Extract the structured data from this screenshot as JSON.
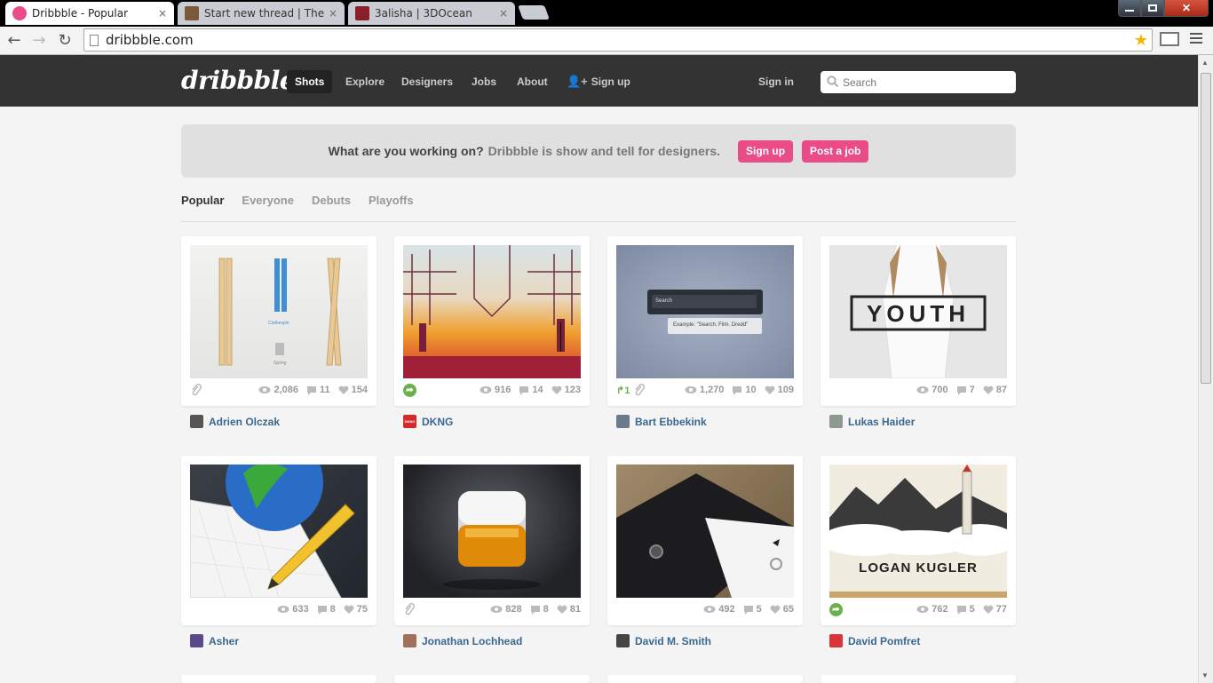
{
  "browser": {
    "tabs": [
      {
        "title": "Dribbble - Popular",
        "close": "×",
        "active": true
      },
      {
        "title": "Start new thread | ThemeFo",
        "close": "×",
        "active": false
      },
      {
        "title": "3alisha | 3DOcean",
        "close": "×",
        "active": false
      }
    ],
    "url": "dribbble.com"
  },
  "header": {
    "logo": "dribbble",
    "nav": [
      "Shots",
      "Explore",
      "Designers",
      "Jobs",
      "About",
      "Sign up"
    ],
    "sign_in": "Sign in",
    "search_placeholder": "Search"
  },
  "banner": {
    "question": "What are you working on?",
    "statement": "Dribbble is show and tell for designers.",
    "signup": "Sign up",
    "post_job": "Post a job"
  },
  "filters": [
    "Popular",
    "Everyone",
    "Debuts",
    "Playoffs"
  ],
  "shots": [
    {
      "player": "Adrien Olczak",
      "views": "2,086",
      "comments": "11",
      "likes": "154",
      "attachment": true,
      "rebound": false,
      "thumb_texts": [
        "Clothespin",
        "Spring"
      ]
    },
    {
      "player": "DKNG",
      "views": "916",
      "comments": "14",
      "likes": "123",
      "attachment": false,
      "rebound": true,
      "avatar_text": "DKNG"
    },
    {
      "player": "Bart Ebbekink",
      "views": "1,270",
      "comments": "10",
      "likes": "109",
      "attachment": true,
      "rebound_count": "1",
      "thumb_texts": [
        "Search",
        "Example: \"Search. Film. Dredd\""
      ]
    },
    {
      "player": "Lukas Haider",
      "views": "700",
      "comments": "7",
      "likes": "87",
      "thumb_texts": [
        "YOUTH"
      ]
    },
    {
      "player": "Asher",
      "views": "633",
      "comments": "8",
      "likes": "75"
    },
    {
      "player": "Jonathan Lochhead",
      "views": "828",
      "comments": "8",
      "likes": "81",
      "attachment": true
    },
    {
      "player": "David M. Smith",
      "views": "492",
      "comments": "5",
      "likes": "65"
    },
    {
      "player": "David Pomfret",
      "views": "762",
      "comments": "5",
      "likes": "77",
      "rebound": true,
      "thumb_texts": [
        "LOGAN KUGLER"
      ]
    }
  ],
  "colors": {
    "pink": "#ea4c89",
    "header": "#333333",
    "link": "#3a6891"
  }
}
